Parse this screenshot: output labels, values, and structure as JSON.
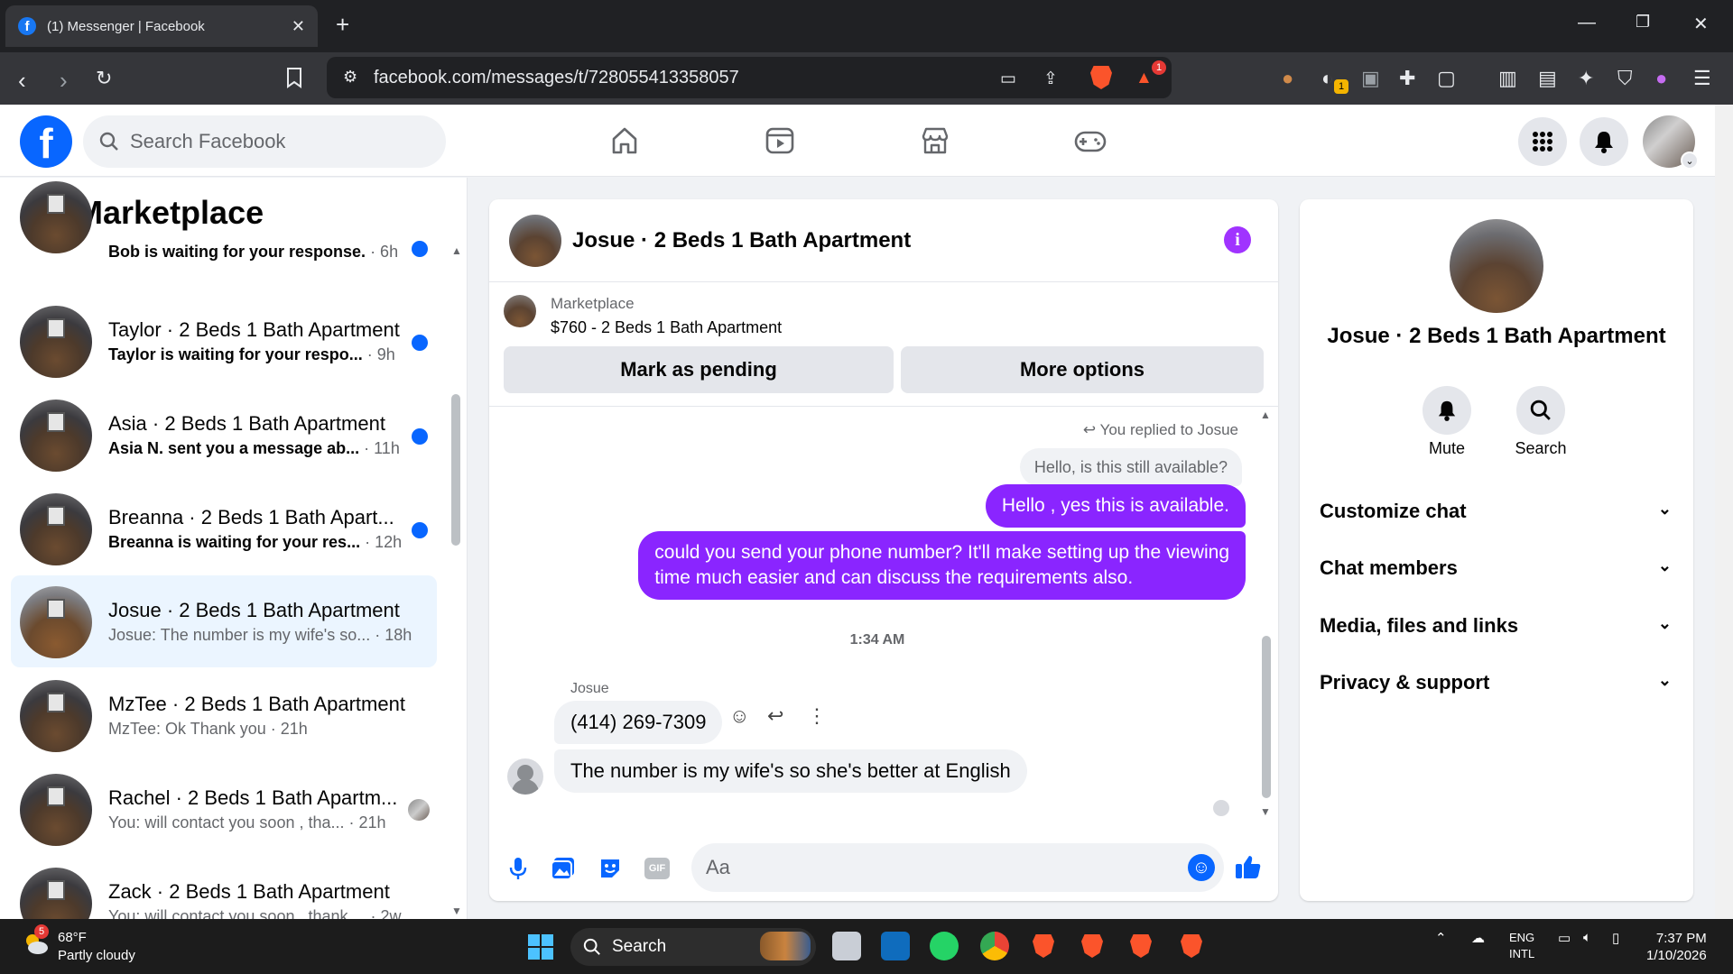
{
  "browser": {
    "tab_title": "(1) Messenger | Facebook",
    "url": "facebook.com/messages/t/728055413358057",
    "brave_badge": "1",
    "ext_badge": "1"
  },
  "fb_header": {
    "logo": "f",
    "search_placeholder": "Search Facebook",
    "nav_icons": [
      "home-icon",
      "video-icon",
      "marketplace-icon",
      "gaming-icon"
    ]
  },
  "left_panel": {
    "title": "Marketplace",
    "conversations": [
      {
        "name": "",
        "sub": "Bob is waiting for your response.",
        "time": "· 6h",
        "unread": true
      },
      {
        "name": "Taylor · 2 Beds 1 Bath Apartment",
        "sub": "Taylor is waiting for your respo...",
        "time": "· 9h",
        "unread": true
      },
      {
        "name": "Asia · 2 Beds 1 Bath Apartment",
        "sub": "Asia N. sent you a message ab...",
        "time": "· 11h",
        "unread": true
      },
      {
        "name": "Breanna · 2 Beds 1 Bath Apart...",
        "sub": "Breanna is waiting for your res...",
        "time": "· 12h",
        "unread": true
      },
      {
        "name": "Josue · 2 Beds 1 Bath Apartment",
        "sub": "Josue: The number is my wife's so...",
        "time": "· 18h",
        "unread": false
      },
      {
        "name": "MzTee · 2 Beds 1 Bath Apartment",
        "sub": "MzTee: Ok Thank you",
        "time": "· 21h",
        "unread": false
      },
      {
        "name": "Rachel · 2 Beds 1 Bath Apartm...",
        "sub": "You: will contact you soon , tha...",
        "time": "· 21h",
        "unread": false
      },
      {
        "name": "Zack · 2 Beds 1 Bath Apartment",
        "sub": "You: will contact you soon , thank ...",
        "time": "· 2w",
        "unread": false
      }
    ]
  },
  "chat": {
    "title": "Josue · 2 Beds 1 Bath Apartment",
    "marketplace_label": "Marketplace",
    "listing": "$760 - 2 Beds 1 Bath Apartment",
    "mark_pending": "Mark as pending",
    "more_options": "More options",
    "replied_to": "You replied to Josue",
    "quoted": "Hello, is this still available?",
    "out_msg_1": "Hello , yes this is available.",
    "out_msg_2_line1": "could you send your phone number? It'll make setting up the viewing",
    "out_msg_2_line2": "time much easier and can discuss the requirements also.",
    "timestamp": "1:34 AM",
    "sender": "Josue",
    "in_msg_1": "(414) 269-7309",
    "in_msg_2": "The number is my wife's so she's better at English",
    "input_placeholder": "Aa",
    "gif_label": "GIF"
  },
  "right_panel": {
    "name": "Josue · 2 Beds 1 Bath Apartment",
    "mute": "Mute",
    "search": "Search",
    "sections": [
      "Customize chat",
      "Chat members",
      "Media, files and links",
      "Privacy & support"
    ]
  },
  "taskbar": {
    "temp": "68°F",
    "condition": "Partly cloudy",
    "weather_badge": "5",
    "search": "Search",
    "lang1": "ENG",
    "lang2": "INTL",
    "time": "7:37 PM",
    "date": "1/10/2026"
  },
  "colors": {
    "fb_blue": "#0866ff",
    "outgoing_bubble": "#8a25ff",
    "unread_dot": "#0866ff",
    "active_row": "#ebf5ff"
  }
}
